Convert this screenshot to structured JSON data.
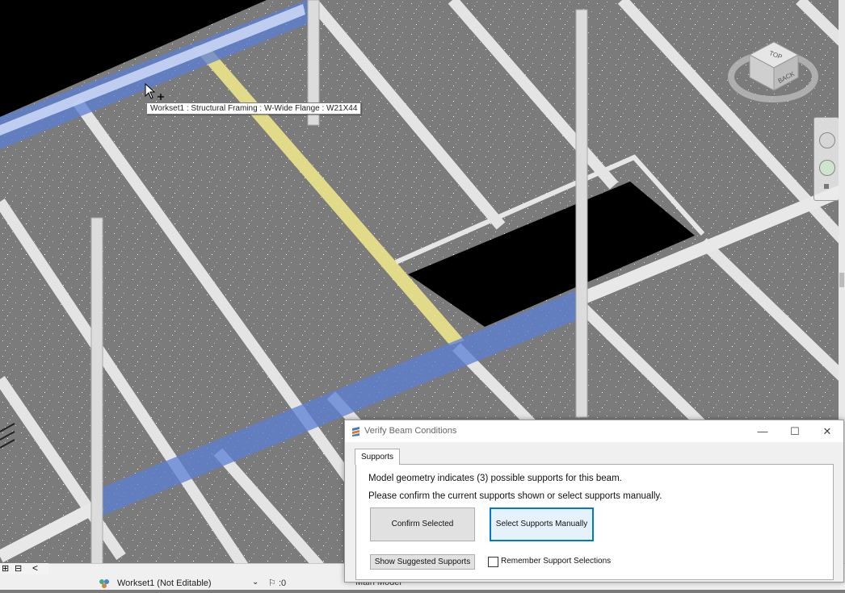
{
  "tooltip": {
    "text": "Workset1 : Structural Framing : W-Wide Flange : W21X44"
  },
  "viewcube": {
    "top_label": "TOP",
    "back_label": "BACK"
  },
  "dialog": {
    "title": "Verify Beam Conditions",
    "minimize_glyph": "—",
    "maximize_glyph": "☐",
    "close_glyph": "✕",
    "tab_label": "Supports",
    "message_line1": "Model geometry indicates (3) possible supports for this beam.",
    "message_line2": "Please confirm the current supports shown or select supports manually.",
    "confirm_button": "Confirm Selected",
    "manual_button": "Select Supports Manually",
    "suggested_button": "Show Suggested Supports",
    "remember_label": "Remember Support Selections",
    "remember_checked": false
  },
  "statusbar": {
    "workset_value": "Workset1 (Not Editable)",
    "editing_count": ":0",
    "model_value": "Main Model",
    "collapse_glyph": "<"
  },
  "colors": {
    "highlight_blue": "#5b7fd6",
    "highlight_yellow": "#f3ec8c",
    "beam_white": "#e6e6e6",
    "slab_gray": "#7c7c7c",
    "void_black": "#000000"
  }
}
